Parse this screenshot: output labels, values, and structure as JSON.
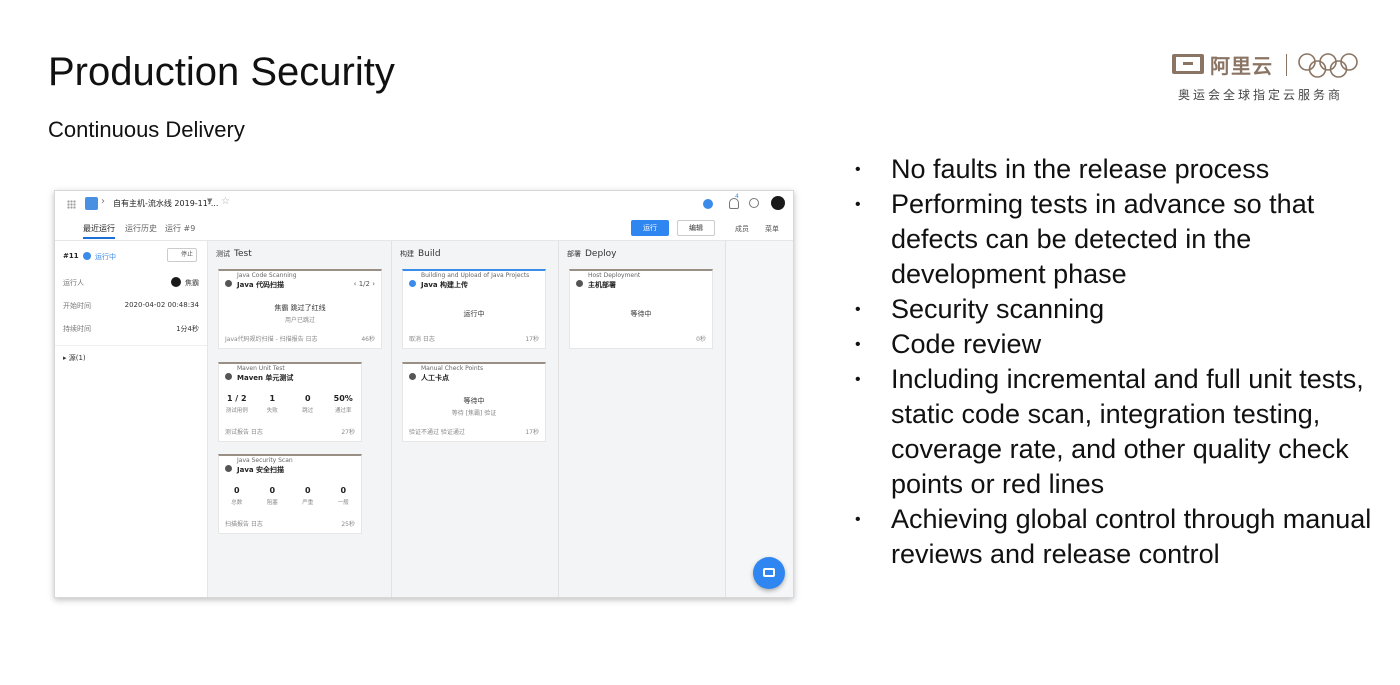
{
  "slide": {
    "title": "Production Security",
    "subtitle": "Continuous Delivery"
  },
  "logo": {
    "brand": "阿里云",
    "tagline": "奥运会全球指定云服务商"
  },
  "bullets": [
    "No faults in the release process",
    "Performing tests in advance so that defects can be detected in the development phase",
    "Security scanning",
    "Code review",
    "Including incremental and full unit tests, static code scan, integration testing, coverage rate, and other quality check points or red lines",
    "Achieving global control through manual reviews and release control"
  ],
  "screenshot": {
    "pipeline_name": "自有主机-流水线 2019-11-...",
    "notification_count": "4",
    "tabs": [
      "最近运行",
      "运行历史",
      "运行 #9"
    ],
    "run_button": "运行",
    "edit_button": "编辑",
    "members_link": "成员",
    "menu_link": "菜单",
    "run": {
      "id": "#11",
      "status": "运行中",
      "stop_button": "停止",
      "runner_label": "运行人",
      "runner_value": "焦霸",
      "start_label": "开始时间",
      "start_value": "2020-04-02 00:48:34",
      "duration_label": "持续时间",
      "duration_value": "1分4秒",
      "source": "源(1)"
    },
    "stages": [
      {
        "cn": "测试",
        "en": "Test",
        "cards": [
          {
            "label": "Java Code Scanning",
            "name": "Java 代码扫描",
            "pager": "1/2",
            "center": "焦霸 跳过了红线",
            "sub": "用户已跳过",
            "foot": "Java代码规约扫描 - 扫描报告    日志",
            "time": "46秒"
          },
          {
            "label": "Maven Unit Test",
            "name": "Maven 单元测试",
            "stats": [
              {
                "n": "1 / 2",
                "l": "测试用例"
              },
              {
                "n": "1",
                "l": "失败"
              },
              {
                "n": "0",
                "l": "跳过"
              },
              {
                "n": "50%",
                "l": "通过率"
              }
            ],
            "foot": "测试报告    日志",
            "time": "27秒"
          },
          {
            "label": "Java Security Scan",
            "name": "Java 安全扫描",
            "stats": [
              {
                "n": "0",
                "l": "总数"
              },
              {
                "n": "0",
                "l": "阻塞"
              },
              {
                "n": "0",
                "l": "严重"
              },
              {
                "n": "0",
                "l": "一般"
              }
            ],
            "foot": "扫描报告    日志",
            "time": "25秒"
          }
        ]
      },
      {
        "cn": "构建",
        "en": "Build",
        "cards": [
          {
            "label": "Building and Upload of Java Projects",
            "name": "Java 构建上传",
            "center": "运行中",
            "foot": "取消    日志",
            "time": "17秒"
          },
          {
            "label": "Manual Check Points",
            "name": "人工卡点",
            "center": "等待中",
            "sub": "等待 [焦霸] 验证",
            "foot": "验证不通过    验证通过",
            "time": "17秒"
          }
        ]
      },
      {
        "cn": "部署",
        "en": "Deploy",
        "cards": [
          {
            "label": "Host Deployment",
            "name": "主机部署",
            "center": "等待中",
            "time": "0秒"
          }
        ]
      }
    ]
  }
}
